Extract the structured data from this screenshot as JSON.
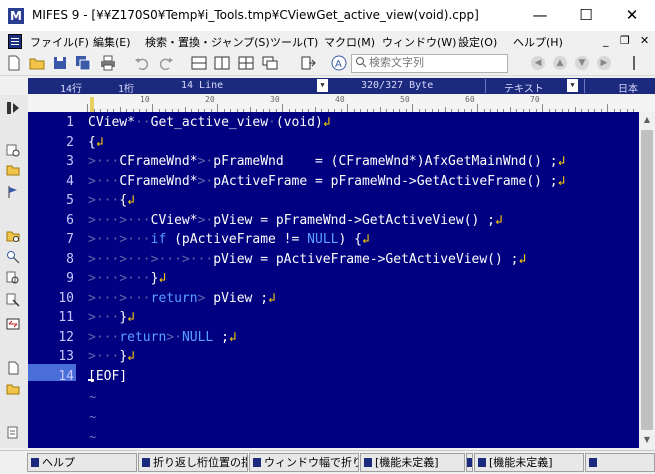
{
  "window": {
    "title": "MIFES 9 - [¥¥Z170S0¥Temp¥i_Tools.tmp¥CViewGet_active_view(void).cpp]",
    "app_icon_letter": "M",
    "minimize": "—",
    "maximize": "☐",
    "close": "✕"
  },
  "menu": {
    "items": [
      "ファイル(F)",
      "編集(E)",
      "検索・置換・ジャンプ(S)",
      "ツール(T)",
      "マクロ(M)",
      "ウィンドウ(W)",
      "設定(O)",
      "ヘルプ(H)"
    ],
    "mdi_min": "_",
    "mdi_restore": "❐",
    "mdi_close": "✕"
  },
  "toolbar": {
    "search_placeholder": "検索文字列",
    "search_icon": "magnifier-icon"
  },
  "infobar": {
    "row": "14行",
    "col": "1桁",
    "line": "14 Line",
    "bytes": "320/327 Byte",
    "mode": "テキスト",
    "encoding": "日本"
  },
  "ruler": {
    "labels": [
      "10",
      "20",
      "30",
      "40",
      "50",
      "60",
      "70"
    ]
  },
  "editor": {
    "current_line": 14,
    "lines": [
      {
        "n": "1",
        "html": "CView*<span class=\"tabmark\">··</span>Get_active_view<span class=\"tabmark\">·</span>(void)<span class=\"ret\">↲</span>"
      },
      {
        "n": "2",
        "html": "{<span class=\"ret\">↲</span>"
      },
      {
        "n": "3",
        "html": "<span class=\"tabmark\">&gt;···</span>CFrameWnd*<span class=\"tabmark\">&gt;·</span>pFrameWnd    = (CFrameWnd*)AfxGetMainWnd() ;<span class=\"ret\">↲</span>"
      },
      {
        "n": "4",
        "html": "<span class=\"tabmark\">&gt;···</span>CFrameWnd*<span class=\"tabmark\">&gt;·</span>pActiveFrame = pFrameWnd-&gt;GetActiveFrame() ;<span class=\"ret\">↲</span>"
      },
      {
        "n": "5",
        "html": "<span class=\"tabmark\">&gt;···</span>{<span class=\"ret\">↲</span>"
      },
      {
        "n": "6",
        "html": "<span class=\"tabmark\">&gt;···&gt;···</span>CView*<span class=\"tabmark\">&gt;·</span>pView = pFrameWnd-&gt;GetActiveView() ;<span class=\"ret\">↲</span>"
      },
      {
        "n": "7",
        "html": "<span class=\"tabmark\">&gt;···&gt;···</span><span class=\"kw\">if</span> (pActiveFrame != <span class=\"kw\">NULL</span>) {<span class=\"ret\">↲</span>"
      },
      {
        "n": "8",
        "html": "<span class=\"tabmark\">&gt;···&gt;···&gt;···&gt;···</span>pView = pActiveFrame-&gt;GetActiveView() ;<span class=\"ret\">↲</span>"
      },
      {
        "n": "9",
        "html": "<span class=\"tabmark\">&gt;···&gt;···</span>}<span class=\"ret\">↲</span>"
      },
      {
        "n": "10",
        "html": "<span class=\"tabmark\">&gt;···&gt;···</span><span class=\"kw\">return</span><span class=\"tabmark\">&gt;</span> pView ;<span class=\"ret\">↲</span>"
      },
      {
        "n": "11",
        "html": "<span class=\"tabmark\">&gt;···</span>}<span class=\"ret\">↲</span>"
      },
      {
        "n": "12",
        "html": "<span class=\"tabmark\">&gt;···</span><span class=\"kw\">return</span><span class=\"tabmark\">&gt;·</span><span class=\"kw\">NULL</span> ;<span class=\"ret\">↲</span>"
      },
      {
        "n": "13",
        "html": "<span class=\"tabmark\">&gt;···</span>}<span class=\"ret\">↲</span>"
      },
      {
        "n": "14",
        "html": "<span class=\"eof\">[EOF]</span>"
      }
    ],
    "tilde": "~"
  },
  "fkeys": [
    "ヘルプ",
    "折り返し桁位置の指",
    "ウィンドウ幅で折り返",
    "[機能未定義]",
    "",
    "[機能未定義]",
    ""
  ],
  "colors": {
    "editor_bg": "#000080",
    "keyword": "#5aa0ff",
    "return_mark": "#ffd300",
    "current_line": "#4a6ed8"
  }
}
